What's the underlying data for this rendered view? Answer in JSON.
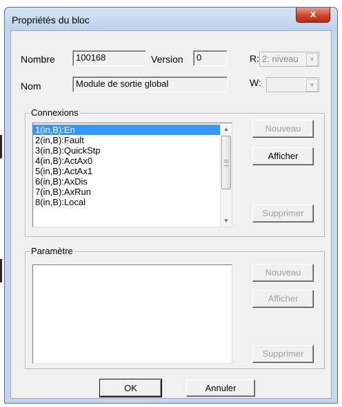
{
  "window": {
    "title": "Propriétés du bloc",
    "close_glyph": "x"
  },
  "fields": {
    "nombre_label": "Nombre",
    "nombre_value": "100168",
    "version_label": "Version",
    "version_value": "0",
    "nom_label": "Nom",
    "nom_value": "Module de sortie global",
    "r_label": "R:",
    "r_value": "2: niveau",
    "w_label": "W:",
    "w_value": ""
  },
  "connexions": {
    "label": "Connexions",
    "items": [
      "1(in,B):En",
      "2(in,B):Fault",
      "3(in,B):QuickStp",
      "4(in,B):ActAx0",
      "5(in,B):ActAx1",
      "6(in,B):AxDis",
      "7(in,B):AxRun",
      "8(in,B):Local"
    ],
    "selected_index": 0,
    "buttons": {
      "nouveau": "Nouveau",
      "afficher": "Afficher",
      "supprimer": "Supprimer"
    }
  },
  "parametre": {
    "label": "Paramètre",
    "items": [],
    "buttons": {
      "nouveau": "Nouveau",
      "afficher": "Afficher",
      "supprimer": "Supprimer"
    }
  },
  "footer": {
    "ok": "OK",
    "annuler": "Annuler"
  },
  "icons": {
    "combo_arrow": "dropdown-arrow-icon",
    "scroll_up": "scroll-up-arrow-icon",
    "scroll_down": "scroll-down-arrow-icon"
  }
}
